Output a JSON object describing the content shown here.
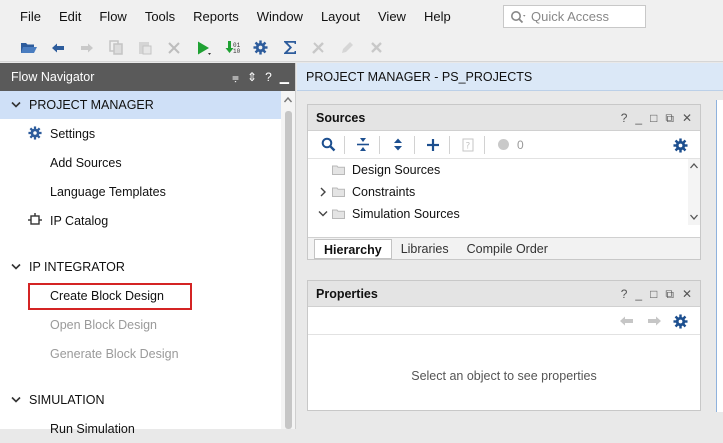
{
  "menu": [
    "File",
    "Edit",
    "Flow",
    "Tools",
    "Reports",
    "Window",
    "Layout",
    "View",
    "Help"
  ],
  "quick_access": {
    "placeholder": "Quick Access"
  },
  "toolbar_icons": [
    "open-folder-icon",
    "undo-icon",
    "redo-icon",
    "copy-icon",
    "paste-icon",
    "delete-icon",
    "run-icon",
    "generate-bitstream-icon",
    "settings-icon",
    "sigma-icon",
    "disabled-tool-icon",
    "disabled-pencil-icon",
    "disabled-cross-icon"
  ],
  "flow_navigator": {
    "title": "Flow Navigator",
    "sections": [
      {
        "title": "PROJECT MANAGER",
        "items": [
          "Settings",
          "Add Sources",
          "Language Templates",
          "IP Catalog"
        ]
      },
      {
        "title": "IP INTEGRATOR",
        "items": [
          "Create Block Design",
          "Open Block Design",
          "Generate Block Design"
        ]
      },
      {
        "title": "SIMULATION",
        "items": [
          "Run Simulation"
        ]
      }
    ]
  },
  "project_manager": {
    "title": "PROJECT MANAGER - PS_PROJECTS"
  },
  "sources": {
    "title": "Sources",
    "count": "0",
    "tree": [
      "Design Sources",
      "Constraints",
      "Simulation Sources"
    ],
    "tabs": [
      "Hierarchy",
      "Libraries",
      "Compile Order"
    ]
  },
  "properties": {
    "title": "Properties",
    "empty_message": "Select an object to see properties"
  },
  "panel_controls": [
    "?",
    "_",
    "□",
    "⧉",
    "✕"
  ]
}
